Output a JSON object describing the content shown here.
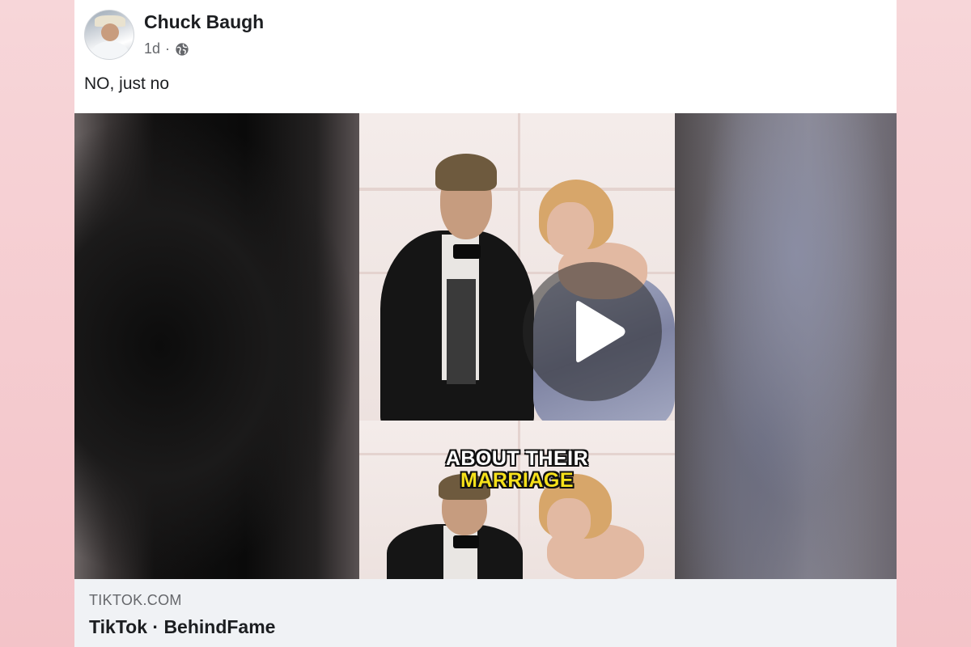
{
  "post": {
    "author": "Chuck Baugh",
    "time": "1d",
    "separator": "·",
    "privacy_icon": "globe-icon",
    "text": "NO, just no"
  },
  "video": {
    "caption_line1": "ABOUT THEIR",
    "caption_line2": "MARRIAGE",
    "play_icon": "play-icon"
  },
  "link_preview": {
    "domain": "TIKTOK.COM",
    "title": "TikTok · BehindFame"
  },
  "colors": {
    "caption_highlight": "#f6e11a",
    "footer_bg": "#f0f2f5",
    "text_primary": "#1c1e21",
    "text_secondary": "#65676b"
  }
}
